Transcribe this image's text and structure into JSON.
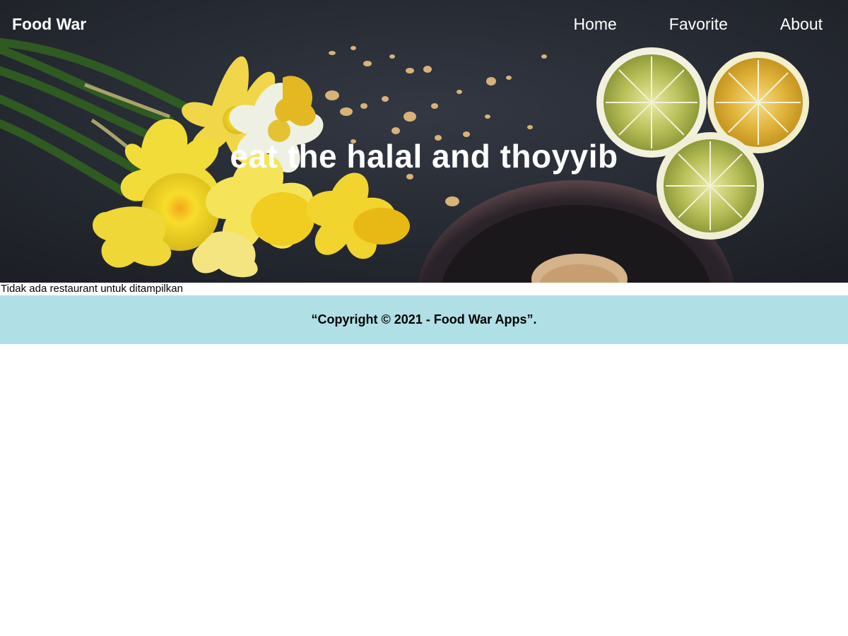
{
  "header": {
    "brand": "Food War",
    "nav": [
      {
        "label": "Home"
      },
      {
        "label": "Favorite"
      },
      {
        "label": "About"
      }
    ]
  },
  "hero": {
    "tagline": "eat the halal and thoyyib"
  },
  "main": {
    "empty_message": "Tidak ada restaurant untuk ditampilkan"
  },
  "footer": {
    "copyright": "“Copyright © 2021 - Food War Apps”."
  }
}
